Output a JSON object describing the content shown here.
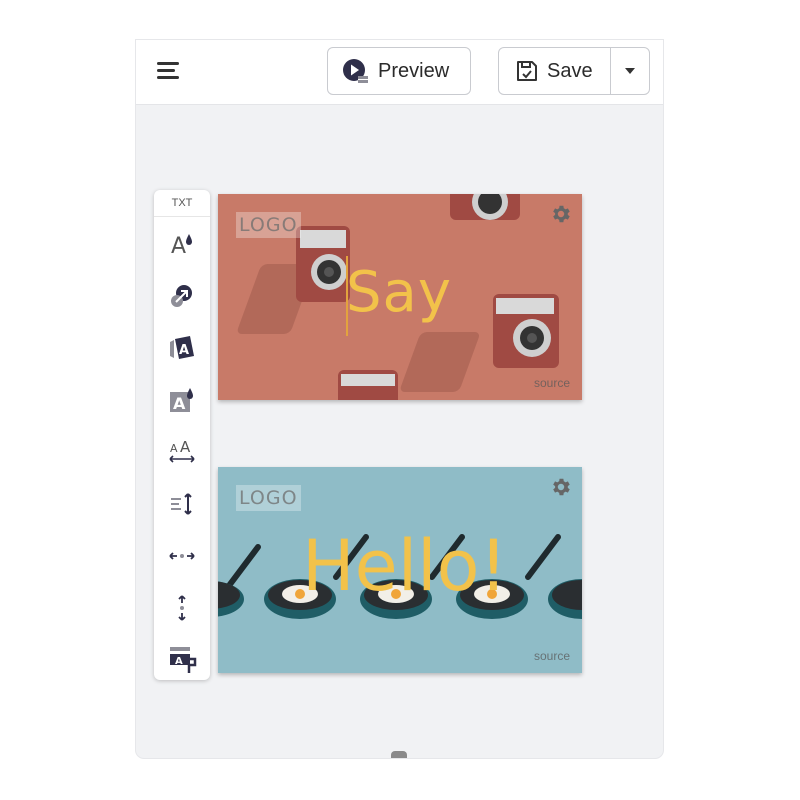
{
  "topbar": {
    "preview_label": "Preview",
    "save_label": "Save"
  },
  "toolbox": {
    "title": "TXT",
    "tools": [
      "text-color-icon",
      "text-effect-icon",
      "text-background-icon",
      "text-fill-icon",
      "letter-spacing-icon",
      "line-height-icon",
      "horizontal-position-icon",
      "vertical-position-icon",
      "text-style-icon"
    ]
  },
  "cards": [
    {
      "logo": "LOGO",
      "headline": "Say",
      "source": "source"
    },
    {
      "logo": "LOGO",
      "headline": "Hello!",
      "source": "source"
    }
  ],
  "colors": {
    "card1_bg": "#c87a68",
    "card2_bg": "#8fbcc7",
    "headline": "#f2c24a"
  }
}
